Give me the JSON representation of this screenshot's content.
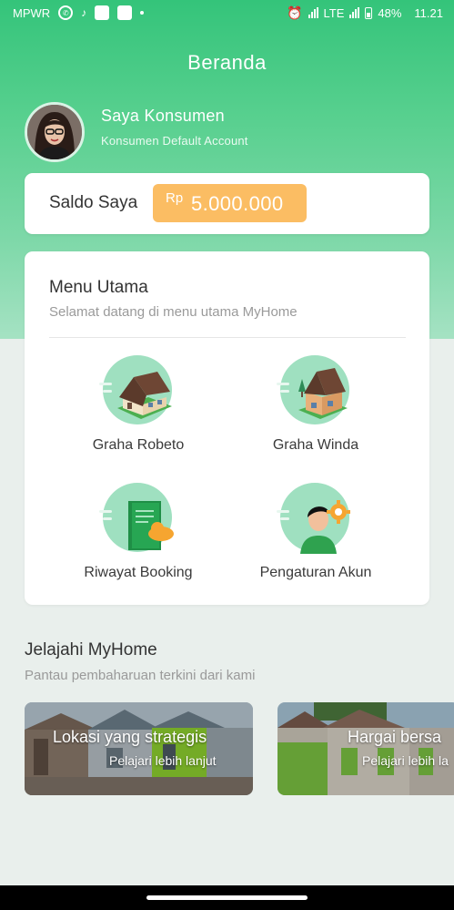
{
  "status_bar": {
    "carrier": "MPWR",
    "network": "LTE",
    "battery": "48%",
    "time": "11.21",
    "icons": [
      "whatsapp-icon",
      "tiktok-icon",
      "notification-square-icon",
      "notification-square-icon",
      "dot-icon",
      "alarm-icon",
      "signal-icon",
      "battery-icon"
    ]
  },
  "header": {
    "title": "Beranda"
  },
  "profile": {
    "name": "Saya Konsumen",
    "subtitle": "Konsumen Default Account"
  },
  "saldo": {
    "label": "Saldo Saya",
    "currency": "Rp",
    "amount": "5.000.000"
  },
  "menu": {
    "title": "Menu Utama",
    "subtitle": "Selamat datang di menu utama MyHome",
    "items": [
      {
        "label": "Graha Robeto",
        "icon": "house-icon"
      },
      {
        "label": "Graha Winda",
        "icon": "house-icon"
      },
      {
        "label": "Riwayat Booking",
        "icon": "booking-history-icon"
      },
      {
        "label": "Pengaturan Akun",
        "icon": "account-settings-icon"
      }
    ]
  },
  "explore": {
    "title": "Jelajahi MyHome",
    "subtitle": "Pantau pembaharuan terkini dari kami",
    "cards": [
      {
        "title": "Lokasi yang strategis",
        "more": "Pelajari lebih lanjut"
      },
      {
        "title": "Hargai bersa",
        "more": "Pelajari lebih la"
      }
    ]
  },
  "colors": {
    "primary_green": "#34c47a",
    "accent_orange": "#fbbd63",
    "background": "#e9efec"
  }
}
